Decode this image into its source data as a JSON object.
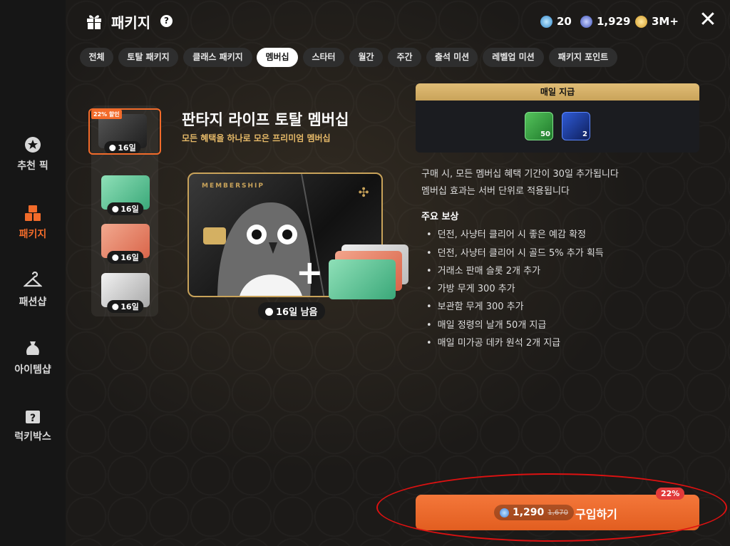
{
  "header": {
    "title": "패키지",
    "help_icon": "?",
    "close_icon": "✕"
  },
  "currencies": [
    {
      "name": "diamond-gem",
      "value": "20",
      "color": "#4fa3e0"
    },
    {
      "name": "blue-orb",
      "value": "1,929",
      "color": "#5a7be0"
    },
    {
      "name": "gold-coin",
      "value": "3M+",
      "color": "#e8b13a"
    }
  ],
  "sidebar": {
    "items": [
      {
        "label": "추천 픽",
        "icon": "star-badge-icon",
        "active": false
      },
      {
        "label": "패키지",
        "icon": "boxes-icon",
        "active": true
      },
      {
        "label": "패션샵",
        "icon": "hanger-icon",
        "active": false
      },
      {
        "label": "아이템샵",
        "icon": "pouch-icon",
        "active": false
      },
      {
        "label": "럭키박스",
        "icon": "mystery-box-icon",
        "active": false
      }
    ]
  },
  "tabs": [
    {
      "label": "전체",
      "active": false
    },
    {
      "label": "토탈 패키지",
      "active": false
    },
    {
      "label": "클래스 패키지",
      "active": false
    },
    {
      "label": "멤버십",
      "active": true
    },
    {
      "label": "스타터",
      "active": false
    },
    {
      "label": "월간",
      "active": false
    },
    {
      "label": "주간",
      "active": false
    },
    {
      "label": "출석 미션",
      "active": false
    },
    {
      "label": "레벨업 미션",
      "active": false
    },
    {
      "label": "패키지 포인트",
      "active": false
    }
  ],
  "package_list": {
    "discount_tag": "22% 할인",
    "items": [
      {
        "days": "16일",
        "color": "#3a3a3a",
        "selected": true
      },
      {
        "days": "16일",
        "color": "#5fbf94",
        "selected": false
      },
      {
        "days": "16일",
        "color": "#e8846a",
        "selected": false
      },
      {
        "days": "16일",
        "color": "#c9c9c9",
        "selected": false
      }
    ]
  },
  "hero": {
    "title": "판타지 라이프 토탈 멤버십",
    "subtitle": "모든 혜택을 하나로 모은 프리미엄 멤버십",
    "card_label": "MEMBERSHIP",
    "remaining": "16일 남음"
  },
  "daily": {
    "title": "매일 지급",
    "items": [
      {
        "icon": "wing-feather-icon",
        "count": "50",
        "color": "#2f8f3a"
      },
      {
        "icon": "blue-gem-icon",
        "count": "2",
        "color": "#1e3a8a"
      }
    ]
  },
  "info": [
    "구매 시, 모든 멤버십 혜택 기간이 30일 추가됩니다",
    "멤버십 효과는 서버 단위로 적용됩니다"
  ],
  "rewards": {
    "title": "주요 보상",
    "items": [
      "던전, 사냥터 클리어 시 좋은 예감 확정",
      "던전, 사냥터 클리어 시 골드 5% 추가 획득",
      "거래소 판매 슬롯 2개 추가",
      "가방 무게 300 추가",
      "보관함 무게 300 추가",
      "매일 정령의 날개 50개 지급",
      "매일 미가공 데카 원석 2개 지급"
    ]
  },
  "buy": {
    "price": "1,290",
    "old_price": "1,670",
    "label": "구입하기",
    "discount": "22%"
  }
}
